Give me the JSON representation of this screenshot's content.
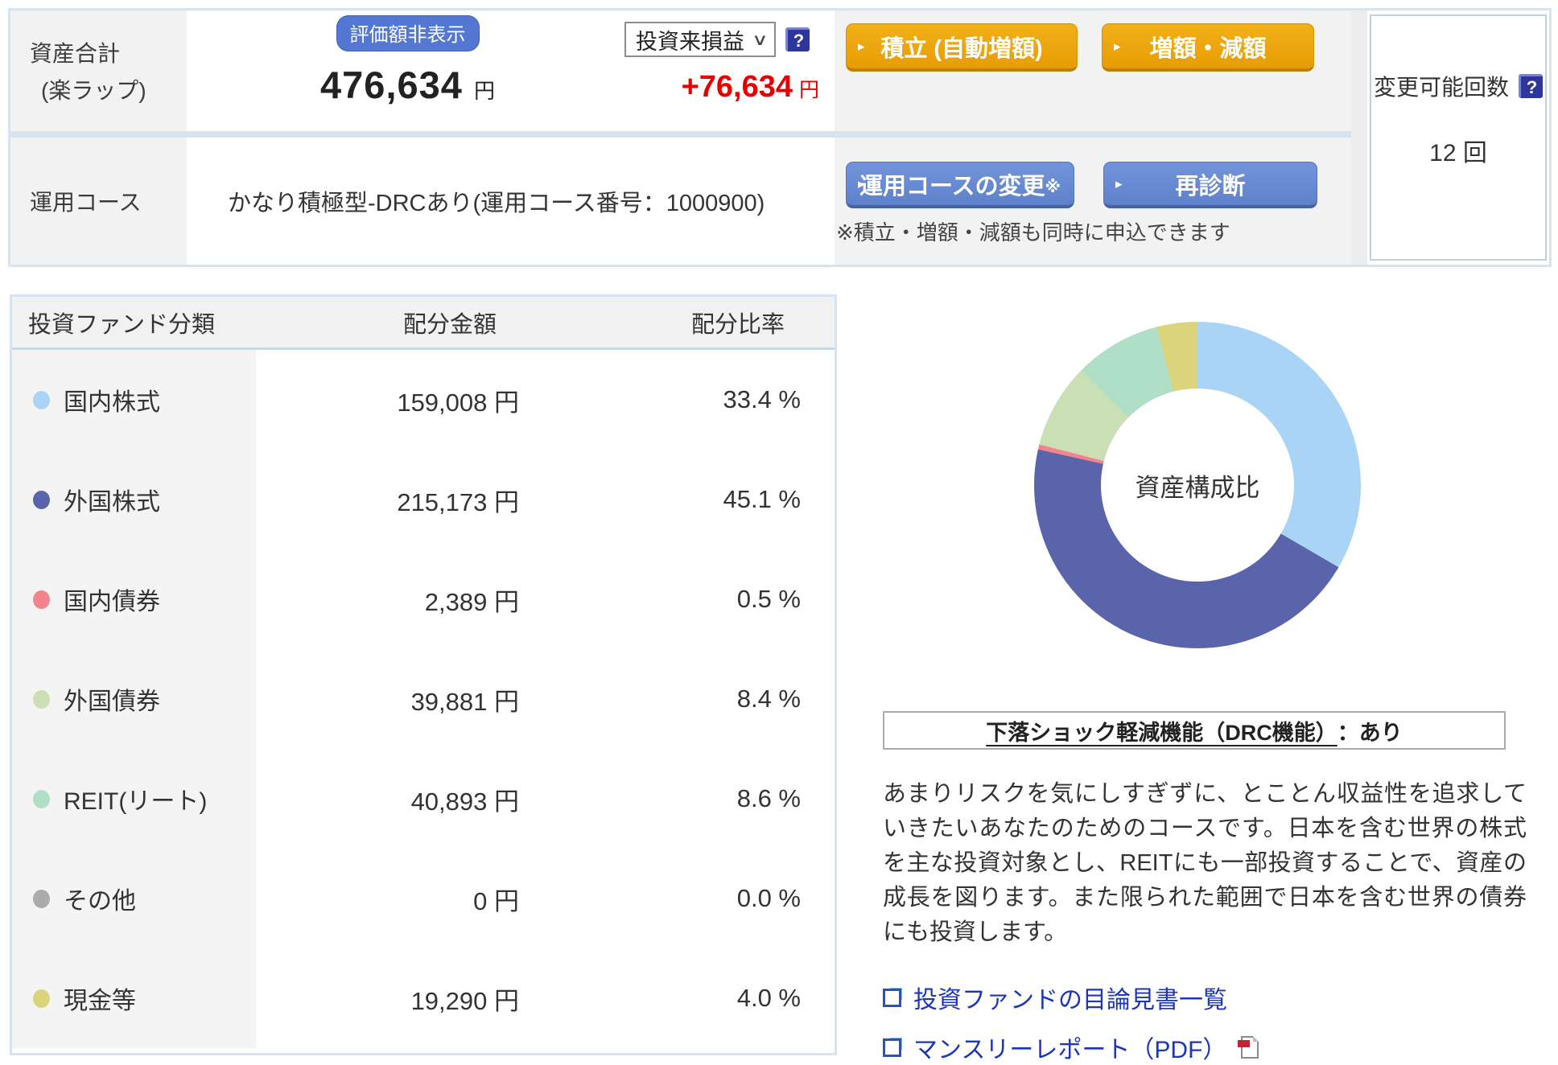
{
  "summary": {
    "asset_label_line1": "資産合計",
    "asset_label_line2": "(楽ラップ)",
    "hide_value_button": "評価額非表示",
    "total_value": "476,634",
    "total_unit": "円",
    "pl_select_value": "投資来損益",
    "pl_value": "+76,634",
    "pl_unit": "円",
    "tsumitate_button": "積立 (自動増額)",
    "zougaku_button": "増額・減額",
    "course_label": "運用コース",
    "course_value": "かなり積極型-DRCあり(運用コース番号：1000900)",
    "course_change_button": "運用コースの変更",
    "course_change_suffix": "※",
    "rediagnosis_button": "再診断",
    "action_note": "※積立・増額・減額も同時に申込できます",
    "change_count_label": "変更可能回数",
    "change_count_value": "12 回"
  },
  "allocation_table": {
    "headers": [
      "投資ファンド分類",
      "配分金額",
      "配分比率"
    ],
    "rows": [
      {
        "label": "国内株式",
        "color": "#A9D4F5",
        "amount": "159,008 円",
        "ratio": "33.4 %"
      },
      {
        "label": "外国株式",
        "color": "#5A64AB",
        "amount": "215,173 円",
        "ratio": "45.1 %"
      },
      {
        "label": "国内債券",
        "color": "#F4838D",
        "amount": "2,389 円",
        "ratio": "0.5 %"
      },
      {
        "label": "外国債券",
        "color": "#CBDFB5",
        "amount": "39,881 円",
        "ratio": "8.4 %"
      },
      {
        "label": "REIT(リート)",
        "color": "#B0DFC7",
        "amount": "40,893 円",
        "ratio": "8.6 %"
      },
      {
        "label": "その他",
        "color": "#ABABAB",
        "amount": "0 円",
        "ratio": "0.0 %"
      },
      {
        "label": "現金等",
        "color": "#DCD47B",
        "amount": "19,290 円",
        "ratio": "4.0 %"
      }
    ]
  },
  "chart_data": {
    "type": "pie",
    "donut": true,
    "center_label": "資産構成比",
    "series": [
      {
        "name": "国内株式",
        "value": 33.4,
        "color": "#A9D4F5"
      },
      {
        "name": "外国株式",
        "value": 45.1,
        "color": "#5A64AB"
      },
      {
        "name": "国内債券",
        "value": 0.5,
        "color": "#F4838D"
      },
      {
        "name": "外国債券",
        "value": 8.4,
        "color": "#CBDFB5"
      },
      {
        "name": "REIT(リート)",
        "value": 8.6,
        "color": "#B0DFC7"
      },
      {
        "name": "その他",
        "value": 0.0,
        "color": "#ABABAB"
      },
      {
        "name": "現金等",
        "value": 4.0,
        "color": "#DCD47B"
      }
    ]
  },
  "drc": {
    "title": "下落ショック軽減機能（DRC機能）",
    "value": "：あり"
  },
  "description": "あまりリスクを気にしすぎずに、とことん収益性を追求していきたいあなたのためのコースです。日本を含む世界の株式を主な投資対象とし、REITにも一部投資することで、資産の成長を図ります。また限られた範囲で日本を含む世界の債券にも投資します。",
  "links": [
    {
      "label": "投資ファンドの目論見書一覧"
    },
    {
      "label": "マンスリーレポート（PDF）"
    }
  ],
  "icons": {
    "button_arrow": "▸",
    "chevron_down": "∨",
    "help": "?"
  },
  "colors": {
    "orange_button": "#EDA40A",
    "blue_button": "#6989D2",
    "badge_blue": "#5377D2",
    "link_blue": "#1C35BB",
    "profit_red": "#E80000",
    "frame_blue": "#D7E3EE"
  }
}
